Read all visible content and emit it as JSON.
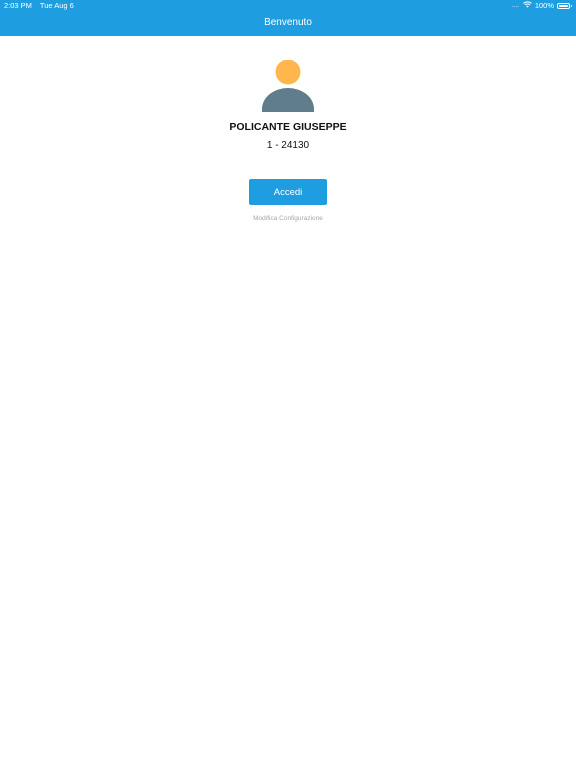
{
  "status_bar": {
    "time": "2:03 PM",
    "date": "Tue Aug 6",
    "signal_dots": "....",
    "wifi_icon": "wifi-icon",
    "battery_percent": "100%",
    "battery_icon": "battery-icon",
    "battery_level": 1.0
  },
  "header": {
    "title": "Benvenuto",
    "background_color": "#1e9ee0"
  },
  "user": {
    "avatar_icon": "user-avatar-icon",
    "avatar_head_color": "#ffb74d",
    "avatar_body_color": "#607d8b",
    "name": "POLICANTE GIUSEPPE",
    "code": "1 - 24130"
  },
  "actions": {
    "login_label": "Accedi",
    "login_color": "#1e9ee0",
    "config_label": "Modifica Configurazione"
  }
}
